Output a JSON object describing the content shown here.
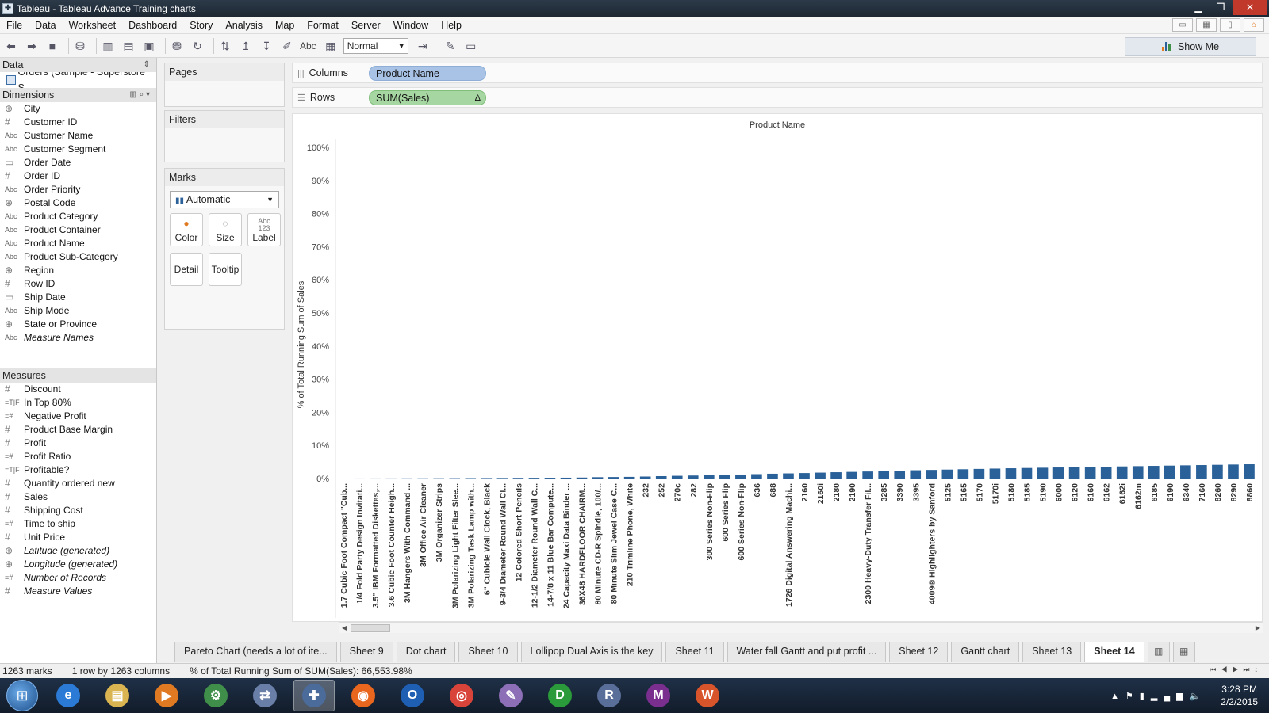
{
  "window": {
    "title": "Tableau - Tableau Advance Training charts"
  },
  "menu": [
    "File",
    "Data",
    "Worksheet",
    "Dashboard",
    "Story",
    "Analysis",
    "Map",
    "Format",
    "Server",
    "Window",
    "Help"
  ],
  "toolbar": {
    "fit_value": "Normal",
    "abc_label": "Abc",
    "show_me": "Show Me"
  },
  "data_pane": {
    "header": "Data",
    "datasource": "Orders (Sample - Superstore S...",
    "dimensions_header": "Dimensions",
    "dimensions": [
      {
        "type": "geo",
        "name": "City"
      },
      {
        "type": "num",
        "name": "Customer ID"
      },
      {
        "type": "abc",
        "name": "Customer Name"
      },
      {
        "type": "abc",
        "name": "Customer Segment"
      },
      {
        "type": "date",
        "name": "Order Date"
      },
      {
        "type": "num",
        "name": "Order ID"
      },
      {
        "type": "abc",
        "name": "Order Priority"
      },
      {
        "type": "geo",
        "name": "Postal Code"
      },
      {
        "type": "abc",
        "name": "Product Category"
      },
      {
        "type": "abc",
        "name": "Product Container"
      },
      {
        "type": "abc",
        "name": "Product Name"
      },
      {
        "type": "abc",
        "name": "Product Sub-Category"
      },
      {
        "type": "geo",
        "name": "Region"
      },
      {
        "type": "num",
        "name": "Row ID"
      },
      {
        "type": "date",
        "name": "Ship Date"
      },
      {
        "type": "abc",
        "name": "Ship Mode"
      },
      {
        "type": "geo",
        "name": "State or Province"
      },
      {
        "type": "abc",
        "name": "Measure Names",
        "italic": true
      }
    ],
    "measures_header": "Measures",
    "measures": [
      {
        "type": "num",
        "name": "Discount"
      },
      {
        "type": "tf",
        "name": "In Top 80%"
      },
      {
        "type": "calc",
        "name": "Negative Profit"
      },
      {
        "type": "num",
        "name": "Product Base Margin"
      },
      {
        "type": "num",
        "name": "Profit"
      },
      {
        "type": "calc",
        "name": "Profit Ratio"
      },
      {
        "type": "tf",
        "name": "Profitable?"
      },
      {
        "type": "num",
        "name": "Quantity ordered new"
      },
      {
        "type": "num",
        "name": "Sales"
      },
      {
        "type": "num",
        "name": "Shipping Cost"
      },
      {
        "type": "calc",
        "name": "Time to ship"
      },
      {
        "type": "num",
        "name": "Unit Price"
      },
      {
        "type": "geo",
        "name": "Latitude (generated)",
        "italic": true
      },
      {
        "type": "geo",
        "name": "Longitude (generated)",
        "italic": true
      },
      {
        "type": "calc",
        "name": "Number of Records",
        "italic": true
      },
      {
        "type": "num",
        "name": "Measure Values",
        "italic": true
      }
    ]
  },
  "cards": {
    "pages": "Pages",
    "filters": "Filters",
    "marks": "Marks",
    "mark_type": "Automatic",
    "buttons": {
      "color": "Color",
      "size": "Size",
      "label": "Label",
      "detail": "Detail",
      "tooltip": "Tooltip",
      "label_icon_text": "Abc\n123"
    }
  },
  "shelves": {
    "columns_label": "Columns",
    "columns_pill": "Product Name",
    "rows_label": "Rows",
    "rows_pill": "SUM(Sales)",
    "rows_pill_flag": "Δ"
  },
  "chart_data": {
    "type": "bar",
    "title": "Product Name",
    "ylabel": "% of Total Running Sum of Sales",
    "xlabel": "",
    "ylim": [
      0,
      1.0
    ],
    "yticks": [
      "0%",
      "10%",
      "20%",
      "30%",
      "40%",
      "50%",
      "60%",
      "70%",
      "80%",
      "90%",
      "100%"
    ],
    "bar_color": "#2a6199",
    "categories": [
      "1.7 Cubic Foot Compact \"Cub...",
      "1/4 Fold Party Design Invitati...",
      "3.5\" IBM Formatted Diskettes,...",
      "3.6 Cubic Foot Counter Heigh...",
      "3M Hangers With Command ...",
      "3M Office Air Cleaner",
      "3M Organizer Strips",
      "3M Polarizing Light Filter Slee...",
      "3M Polarizing Task Lamp with...",
      "6\" Cubicle Wall Clock, Black",
      "9-3/4 Diameter Round Wall Cl...",
      "12 Colored Short Pencils",
      "12-1/2 Diameter Round Wall C...",
      "14-7/8 x 11 Blue Bar Compute...",
      "24 Capacity Maxi Data Binder ...",
      "36X48 HARDFLOOR CHAIRM...",
      "80 Minute CD-R Spindle, 100/...",
      "80 Minute Slim Jewel Case C...",
      "210 Trimline Phone, White",
      "232",
      "252",
      "270c",
      "282",
      "300 Series Non-Flip",
      "600 Series Flip",
      "600 Series Non-Flip",
      "636",
      "688",
      "1726 Digital Answering Machi...",
      "2160",
      "2160i",
      "2180",
      "2190",
      "2300 Heavy-Duty Transfer Fil...",
      "3285",
      "3390",
      "3395",
      "4009® Highlighters by Sanford",
      "5125",
      "5165",
      "5170",
      "5170i",
      "5180",
      "5185",
      "5190",
      "6000",
      "6120",
      "6160",
      "6162",
      "6162i",
      "6162m",
      "6185",
      "6190",
      "6340",
      "7160",
      "8260",
      "8290",
      "8860"
    ],
    "values": [
      0.0,
      0.0001,
      0.0002,
      0.0003,
      0.0005,
      0.0006,
      0.0008,
      0.001,
      0.0012,
      0.0014,
      0.0016,
      0.0019,
      0.0021,
      0.0023,
      0.0025,
      0.0029,
      0.004,
      0.0045,
      0.005,
      0.006,
      0.0072,
      0.0082,
      0.009,
      0.01,
      0.011,
      0.012,
      0.0132,
      0.0145,
      0.0155,
      0.0165,
      0.0178,
      0.019,
      0.02,
      0.0212,
      0.0225,
      0.0238,
      0.025,
      0.026,
      0.027,
      0.028,
      0.029,
      0.03,
      0.031,
      0.0318,
      0.0326,
      0.0334,
      0.0342,
      0.035,
      0.0358,
      0.0366,
      0.0374,
      0.0382,
      0.039,
      0.0398,
      0.0406,
      0.0414,
      0.0422,
      0.043
    ]
  },
  "tabs": [
    {
      "label": "Pareto Chart (needs a lot of ite...",
      "active": false
    },
    {
      "label": "Sheet 9",
      "active": false
    },
    {
      "label": "Dot chart",
      "active": false
    },
    {
      "label": "Sheet 10",
      "active": false
    },
    {
      "label": "Lollipop  Dual Axis is the key",
      "active": false
    },
    {
      "label": "Sheet 11",
      "active": false
    },
    {
      "label": "Water fall Gantt and put profit ...",
      "active": false
    },
    {
      "label": "Sheet 12",
      "active": false
    },
    {
      "label": "Gantt chart",
      "active": false
    },
    {
      "label": "Sheet 13",
      "active": false
    },
    {
      "label": "Sheet 14",
      "active": true
    }
  ],
  "status": {
    "marks": "1263 marks",
    "dims": "1 row by 1263 columns",
    "summary": "% of Total Running Sum of SUM(Sales): 66,553.98%"
  },
  "taskbar": {
    "clock_time": "3:28 PM",
    "clock_date": "2/2/2015",
    "apps": [
      {
        "name": "internet-explorer",
        "glyph": "e",
        "color": "#2b7bd6"
      },
      {
        "name": "file-explorer",
        "glyph": "▤",
        "color": "#d9b451"
      },
      {
        "name": "media-player",
        "glyph": "▶",
        "color": "#e07a22"
      },
      {
        "name": "app-settings",
        "glyph": "⚙",
        "color": "#3f8f4a"
      },
      {
        "name": "network-app",
        "glyph": "⇄",
        "color": "#6a7fa8"
      },
      {
        "name": "tableau",
        "glyph": "✚",
        "color": "#4b6b9b",
        "active": true
      },
      {
        "name": "firefox",
        "glyph": "◉",
        "color": "#e8661d"
      },
      {
        "name": "outlook",
        "glyph": "O",
        "color": "#1f5fb3"
      },
      {
        "name": "chrome",
        "glyph": "◎",
        "color": "#d8443a"
      },
      {
        "name": "paint",
        "glyph": "✎",
        "color": "#8c6fb7"
      },
      {
        "name": "d-app",
        "glyph": "D",
        "color": "#2a9a3a"
      },
      {
        "name": "r-app",
        "glyph": "R",
        "color": "#5a6e9a"
      },
      {
        "name": "m-app",
        "glyph": "M",
        "color": "#7a2e8e"
      },
      {
        "name": "w-app",
        "glyph": "W",
        "color": "#d8542a"
      }
    ]
  }
}
